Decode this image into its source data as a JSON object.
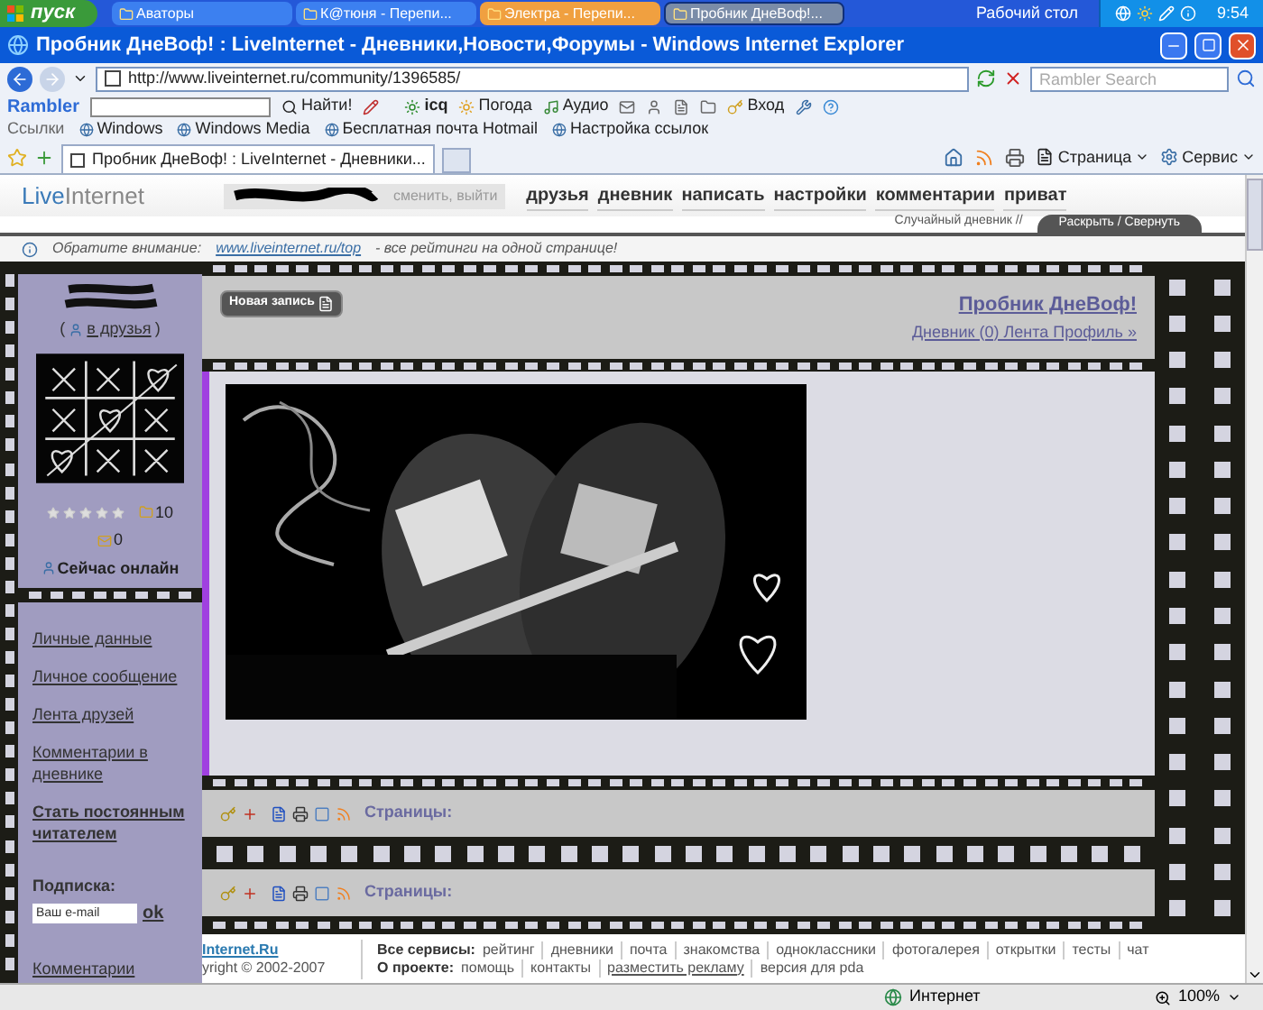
{
  "taskbar": {
    "start": "пуск",
    "tasks": [
      {
        "label": "Аваторы",
        "selected": false,
        "flashing": false
      },
      {
        "label": "К@тюня - Перепи...",
        "selected": false,
        "flashing": false
      },
      {
        "label": "Электра - Перепи...",
        "selected": false,
        "flashing": true
      },
      {
        "label": "Пробник ДнеВоф!...",
        "selected": true,
        "flashing": false
      }
    ],
    "desktop": "Рабочий стол",
    "clock": "9:54"
  },
  "window": {
    "title": "Пробник ДнеВоф! : LiveInternet - Дневники,Новости,Форумы - Windows Internet Explorer"
  },
  "address_bar": {
    "url": "http://www.liveinternet.ru/community/1396585/",
    "search_placeholder": "Rambler Search"
  },
  "rambler_toolbar": {
    "logo": "Rambler",
    "find": "Найти!",
    "icq": "icq",
    "weather": "Погода",
    "audio": "Аудио",
    "login": "Вход"
  },
  "links_bar": {
    "label": "Ссылки",
    "items": [
      "Windows",
      "Windows Media",
      "Бесплатная почта Hotmail",
      "Настройка ссылок"
    ]
  },
  "tabs": [
    {
      "label": "Пробник ДнеВоф! : LiveInternet - Дневники...",
      "selected": true
    }
  ],
  "command_bar": {
    "page": "Страница",
    "tools": "Сервис"
  },
  "site_header": {
    "logo": [
      "Live",
      "Internet"
    ],
    "user_links": "сменить, выйти",
    "nav": [
      "друзья",
      "дневник",
      "написать",
      "настройки",
      "комментарии",
      "приват"
    ],
    "random": "Случайный дневник //",
    "expand": "Раскрыть / Свернуть"
  },
  "notice": {
    "label": "Обратите внимание:",
    "link": "www.liveinternet.ru/top",
    "text": "- все рейтинги на одной странице!"
  },
  "sidebar": {
    "add_friend": {
      "open": "(",
      "label": "в друзья",
      "close": ")"
    },
    "rating": {
      "stars": 0
    },
    "count_a": "10",
    "count_b": "0",
    "online": "Сейчас онлайн",
    "links": [
      {
        "label": "Личные данные",
        "kind": "link"
      },
      {
        "label": "Личное сообщение",
        "kind": "link"
      },
      {
        "label": "Лента друзей",
        "kind": "link"
      },
      {
        "label": "Комментарии в дневнике",
        "kind": "link"
      },
      {
        "label": "Стать постоянным читателем",
        "kind": "strong"
      }
    ],
    "subscribe": {
      "label": "Подписка:",
      "placeholder": "Ваш e-mail",
      "button": "ok"
    },
    "last_link": "Комментарии"
  },
  "main": {
    "new_post": "Новая запись",
    "blog_title": "Пробник ДнеВоф!",
    "blog_links": "Дневник (0) Лента Профиль »",
    "posts": [
      {
        "pages": "Страницы:"
      },
      {
        "pages": "Страницы:"
      }
    ]
  },
  "footer": {
    "brand": "Internet.Ru",
    "copyright": "yright © 2002-2007",
    "services_label": "Все сервисы:",
    "services": [
      "рейтинг",
      "дневники",
      "почта",
      "знакомства",
      "одноклассники",
      "фотогалерея",
      "открытки",
      "тесты",
      "чат"
    ],
    "about_label": "О проекте:",
    "about": [
      {
        "label": "помощь",
        "underlined": false
      },
      {
        "label": "контакты",
        "underlined": false
      },
      {
        "label": "разместить рекламу",
        "underlined": true
      },
      {
        "label": "версия для pda",
        "underlined": false
      }
    ]
  },
  "status_bar": {
    "zone": "Интернет",
    "zoom": "100%"
  }
}
